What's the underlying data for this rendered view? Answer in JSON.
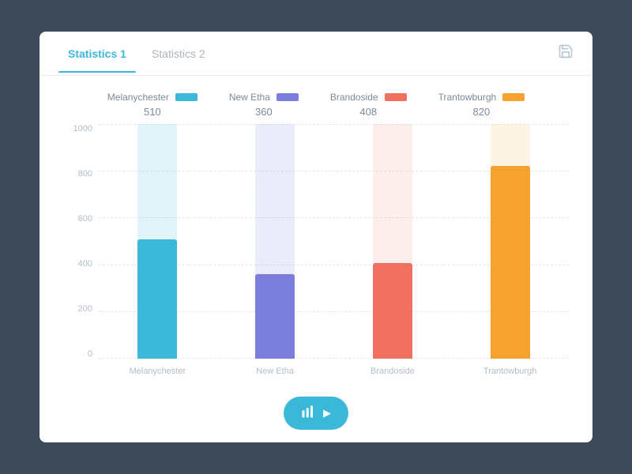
{
  "tabs": [
    {
      "id": "tab1",
      "label": "Statistics 1",
      "active": true
    },
    {
      "id": "tab2",
      "label": "Statistics 2",
      "active": false
    }
  ],
  "legend": [
    {
      "id": "melanychester",
      "label": "Melanychester",
      "value": "510",
      "color": "#3bb8d8"
    },
    {
      "id": "new-etha",
      "label": "New Etha",
      "value": "360",
      "color": "#7b7edb"
    },
    {
      "id": "brandoside",
      "label": "Brandoside",
      "value": "408",
      "color": "#f07060"
    },
    {
      "id": "trantowburgh",
      "label": "Trantowburgh",
      "value": "820",
      "color": "#f5a230"
    }
  ],
  "chart": {
    "y_labels": [
      "0",
      "200",
      "400",
      "600",
      "800",
      "1000"
    ],
    "max": 1000,
    "bars": [
      {
        "id": "melanychester",
        "label": "Melanychester",
        "value": 510,
        "pct": "60%",
        "color_bg": "rgba(59,184,216,0.15)",
        "color_fg": "#3bb8d8",
        "pct_color": "#3bb8d8"
      },
      {
        "id": "new-etha",
        "label": "New Etha",
        "value": 360,
        "pct": "30%",
        "color_bg": "rgba(123,126,219,0.15)",
        "color_fg": "#7b7edb",
        "pct_color": "#7b7edb"
      },
      {
        "id": "brandoside",
        "label": "Brandoside",
        "value": 408,
        "pct": "35%",
        "color_bg": "rgba(240,112,96,0.12)",
        "color_fg": "#f07060",
        "pct_color": "#f07060"
      },
      {
        "id": "trantowburgh",
        "label": "Trantowburgh",
        "value": 820,
        "pct": "85%",
        "color_bg": "rgba(245,162,48,0.12)",
        "color_fg": "#f5a230",
        "pct_color": "#f5a230"
      }
    ]
  },
  "button": {
    "label": "",
    "chart_icon": "📊",
    "arrow_icon": "▶"
  },
  "save_icon": "💾"
}
